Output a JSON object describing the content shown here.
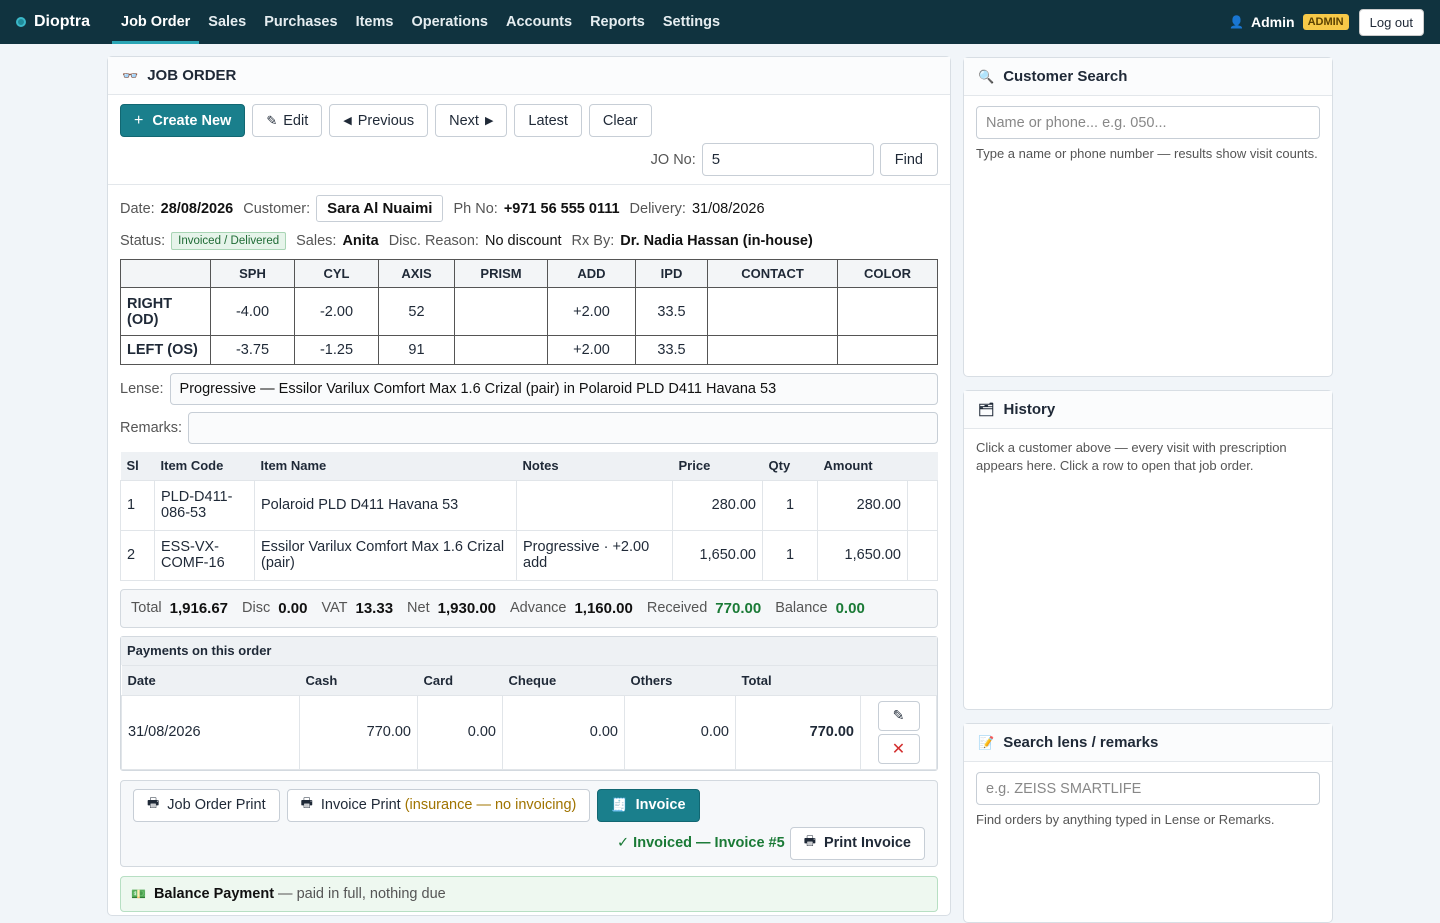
{
  "brand": {
    "name": "Dioptra"
  },
  "nav": [
    "Job Order",
    "Sales",
    "Purchases",
    "Items",
    "Operations",
    "Accounts",
    "Reports",
    "Settings"
  ],
  "user": {
    "name": "Admin",
    "role": "ADMIN",
    "logout": "Log out"
  },
  "job_order": {
    "title": "JOB ORDER",
    "toolbar": {
      "create": "Create New",
      "edit": "Edit",
      "previous": "Previous",
      "next": "Next",
      "latest": "Latest",
      "clear": "Clear"
    },
    "jo_label": "JO No:",
    "jo_value": "5",
    "find": "Find",
    "date_label": "Date:",
    "date": "28/08/2026",
    "customer_label": "Customer:",
    "customer": "Sara Al Nuaimi",
    "phone_label": "Ph No:",
    "phone": "+971 56 555 0111",
    "delivery_label": "Delivery:",
    "delivery": "31/08/2026",
    "status_label": "Status:",
    "status": "Invoiced / Delivered",
    "sales_label": "Sales:",
    "sales": "Anita",
    "disc_label": "Disc. Reason:",
    "disc_reason": "No discount",
    "rx_by_label": "Rx By:",
    "rx_by": "Dr. Nadia Hassan (in-house)",
    "rx_headers": [
      "",
      "SPH",
      "CYL",
      "AXIS",
      "PRISM",
      "ADD",
      "IPD",
      "CONTACT",
      "COLOR"
    ],
    "rx_rows": [
      {
        "label": "RIGHT (OD)",
        "sph": "-4.00",
        "cyl": "-2.00",
        "axis": "52",
        "prism": "",
        "add": "+2.00",
        "ipd": "33.5",
        "contact": "",
        "color": ""
      },
      {
        "label": "LEFT (OS)",
        "sph": "-3.75",
        "cyl": "-1.25",
        "axis": "91",
        "prism": "",
        "add": "+2.00",
        "ipd": "33.5",
        "contact": "",
        "color": ""
      }
    ],
    "lense_label": "Lense:",
    "lense": "Progressive — Essilor Varilux Comfort Max 1.6 Crizal (pair) in Polaroid PLD D411 Havana 53",
    "remarks_label": "Remarks:",
    "remarks": "",
    "item_headers": [
      "Sl",
      "Item Code",
      "Item Name",
      "Notes",
      "Price",
      "Qty",
      "Amount"
    ],
    "items": [
      {
        "sl": "1",
        "code": "PLD-D411-086-53",
        "name": "Polaroid PLD D411 Havana 53",
        "notes": "",
        "price": "280.00",
        "qty": "1",
        "amount": "280.00"
      },
      {
        "sl": "2",
        "code": "ESS-VX-COMF-16",
        "name": "Essilor Varilux Comfort Max 1.6 Crizal (pair)",
        "notes": "Progressive · +2.00 add",
        "price": "1,650.00",
        "qty": "1",
        "amount": "1,650.00"
      }
    ],
    "totals": {
      "total_label": "Total",
      "total": "1,916.67",
      "disc_label": "Disc",
      "disc": "0.00",
      "vat_label": "VAT",
      "vat": "13.33",
      "net_label": "Net",
      "net": "1,930.00",
      "advance_label": "Advance",
      "advance": "1,160.00",
      "received_label": "Received",
      "received": "770.00",
      "balance_label": "Balance",
      "balance": "0.00"
    },
    "payments": {
      "title": "Payments on this order",
      "headers": [
        "Date",
        "Cash",
        "Card",
        "Cheque",
        "Others",
        "Total"
      ],
      "rows": [
        {
          "date": "31/08/2026",
          "cash": "770.00",
          "card": "0.00",
          "cheque": "0.00",
          "others": "0.00",
          "total": "770.00"
        }
      ]
    },
    "prints": {
      "job_order_print": "Job Order Print",
      "invoice_print": "Invoice Print",
      "invoice_print_note": "(insurance — no invoicing)",
      "invoice": "Invoice",
      "invoiced_status": "✓ Invoiced — Invoice #5",
      "print_invoice": "Print Invoice"
    },
    "balance_payment": {
      "title": "Balance Payment",
      "note": "— paid in full, nothing due"
    }
  },
  "customer_search": {
    "title": "Customer Search",
    "placeholder": "Name or phone... e.g. 050...",
    "help": "Type a name or phone number — results show visit counts."
  },
  "history": {
    "title": "History",
    "help": "Click a customer above — every visit with prescription appears here. Click a row to open that job order."
  },
  "lens_search": {
    "title": "Search lens / remarks",
    "placeholder": "e.g. ZEISS SMARTLIFE",
    "help": "Find orders by anything typed in Lense or Remarks."
  },
  "colors": {
    "topbar": "#10333f",
    "accent": "#1a7f8c",
    "success": "#1a7a36"
  }
}
